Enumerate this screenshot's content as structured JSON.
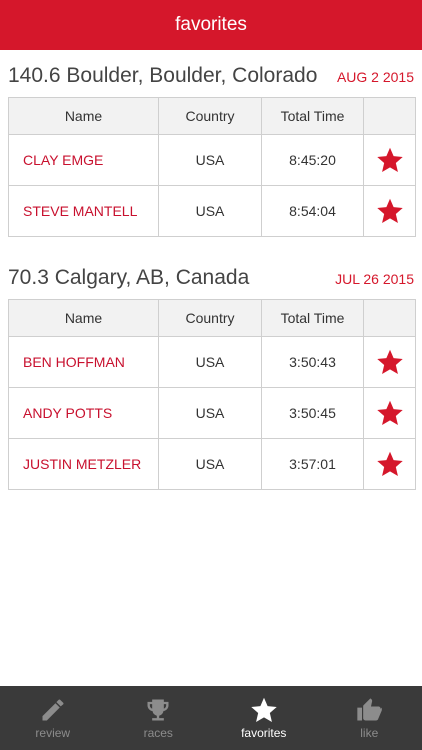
{
  "header": {
    "title": "favorites"
  },
  "races": [
    {
      "title": "140.6 Boulder, Boulder, Colorado",
      "date": "AUG 2 2015",
      "columns": [
        "Name",
        "Country",
        "Total Time"
      ],
      "rows": [
        {
          "name": "CLAY EMGE",
          "country": "USA",
          "time": "8:45:20",
          "favorited": true
        },
        {
          "name": "STEVE MANTELL",
          "country": "USA",
          "time": "8:54:04",
          "favorited": true
        }
      ]
    },
    {
      "title": "70.3 Calgary, AB, Canada",
      "date": "JUL 26 2015",
      "columns": [
        "Name",
        "Country",
        "Total Time"
      ],
      "rows": [
        {
          "name": "BEN HOFFMAN",
          "country": "USA",
          "time": "3:50:43",
          "favorited": true
        },
        {
          "name": "ANDY POTTS",
          "country": "USA",
          "time": "3:50:45",
          "favorited": true
        },
        {
          "name": "JUSTIN METZLER",
          "country": "USA",
          "time": "3:57:01",
          "favorited": true
        }
      ]
    }
  ],
  "tabs": [
    {
      "label": "review",
      "icon": "pencil-icon",
      "active": false
    },
    {
      "label": "races",
      "icon": "trophy-icon",
      "active": false
    },
    {
      "label": "favorites",
      "icon": "star-icon",
      "active": true
    },
    {
      "label": "like",
      "icon": "thumbs-up-icon",
      "active": false
    }
  ],
  "colors": {
    "accent": "#d5172b",
    "tabbar": "#3a3a3a",
    "star": "#d5172b"
  }
}
